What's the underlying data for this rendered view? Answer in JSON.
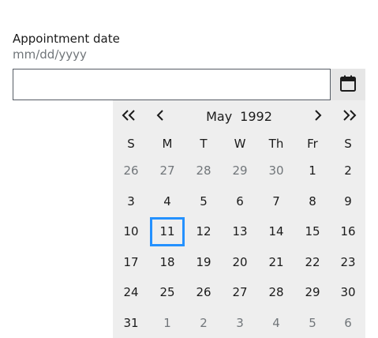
{
  "field": {
    "label": "Appointment date",
    "hint": "mm/dd/yyyy",
    "value": "",
    "toggle_icon": "calendar-icon"
  },
  "calendar": {
    "month": "May",
    "year": "1992",
    "nav": {
      "prev_year_icon": "double-chevron-left-icon",
      "prev_month_icon": "chevron-left-icon",
      "next_month_icon": "chevron-right-icon",
      "next_year_icon": "double-chevron-right-icon"
    },
    "days_of_week": [
      "S",
      "M",
      "T",
      "W",
      "Th",
      "Fr",
      "S"
    ],
    "weeks": [
      [
        {
          "day": "26",
          "outside": true
        },
        {
          "day": "27",
          "outside": true
        },
        {
          "day": "28",
          "outside": true
        },
        {
          "day": "29",
          "outside": true
        },
        {
          "day": "30",
          "outside": true
        },
        {
          "day": "1"
        },
        {
          "day": "2"
        }
      ],
      [
        {
          "day": "3"
        },
        {
          "day": "4"
        },
        {
          "day": "5"
        },
        {
          "day": "6"
        },
        {
          "day": "7"
        },
        {
          "day": "8"
        },
        {
          "day": "9"
        }
      ],
      [
        {
          "day": "10"
        },
        {
          "day": "11",
          "focused": true
        },
        {
          "day": "12"
        },
        {
          "day": "13"
        },
        {
          "day": "14"
        },
        {
          "day": "15"
        },
        {
          "day": "16"
        }
      ],
      [
        {
          "day": "17"
        },
        {
          "day": "18"
        },
        {
          "day": "19"
        },
        {
          "day": "20"
        },
        {
          "day": "21"
        },
        {
          "day": "22"
        },
        {
          "day": "23"
        }
      ],
      [
        {
          "day": "24"
        },
        {
          "day": "25"
        },
        {
          "day": "26"
        },
        {
          "day": "27"
        },
        {
          "day": "28"
        },
        {
          "day": "29"
        },
        {
          "day": "30"
        }
      ],
      [
        {
          "day": "31"
        },
        {
          "day": "1",
          "outside": true
        },
        {
          "day": "2",
          "outside": true
        },
        {
          "day": "3",
          "outside": true
        },
        {
          "day": "4",
          "outside": true
        },
        {
          "day": "5",
          "outside": true
        },
        {
          "day": "6",
          "outside": true
        }
      ]
    ]
  },
  "colors": {
    "focus_ring": "#2491ff",
    "calendar_bg": "#eeeeee",
    "toggle_bg": "#e6e6e6",
    "muted_text": "#71767a",
    "text": "#1b1b1b"
  }
}
